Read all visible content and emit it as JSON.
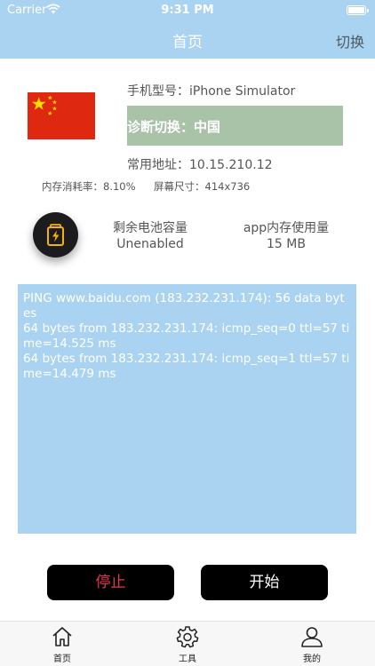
{
  "status_bar": {
    "carrier": "Carrier",
    "time": "9:31 PM"
  },
  "nav": {
    "title": "首页",
    "right_button": "切换"
  },
  "device": {
    "model": "手机型号：iPhone Simulator",
    "diagnosis_switch": "诊断切换：中国",
    "address": "常用地址：10.15.210.12",
    "memory_usage": "内存消耗率：8.10%",
    "screen_size": "屏幕尺寸：414x736"
  },
  "stats": {
    "battery_label": "剩余电池容量",
    "battery_value": "Unenabled",
    "app_memory_label": "app内存使用量",
    "app_memory_value": "15 MB"
  },
  "log": {
    "text": "PING www.baidu.com (183.232.231.174): 56 data bytes\n64 bytes from 183.232.231.174: icmp_seq=0 ttl=57 time=14.525 ms\n64 bytes from 183.232.231.174: icmp_seq=1 ttl=57 time=14.479 ms"
  },
  "buttons": {
    "stop": "停止",
    "start": "开始"
  },
  "tabbar": {
    "home": "首页",
    "tools": "工具",
    "mine": "我的"
  },
  "colors": {
    "nav_bg": "#a9d3f0",
    "switch_bg": "#a9c3a8",
    "stop_text": "#e7354f",
    "button_bg": "#000000",
    "flag_red": "#de2910",
    "flag_star": "#ffde00",
    "battery_icon": "#f5b400"
  },
  "icons": {
    "flag": "china-flag-icon",
    "battery": "battery-charging-icon",
    "home": "home-icon",
    "tools": "gear-icon",
    "mine": "person-icon"
  }
}
